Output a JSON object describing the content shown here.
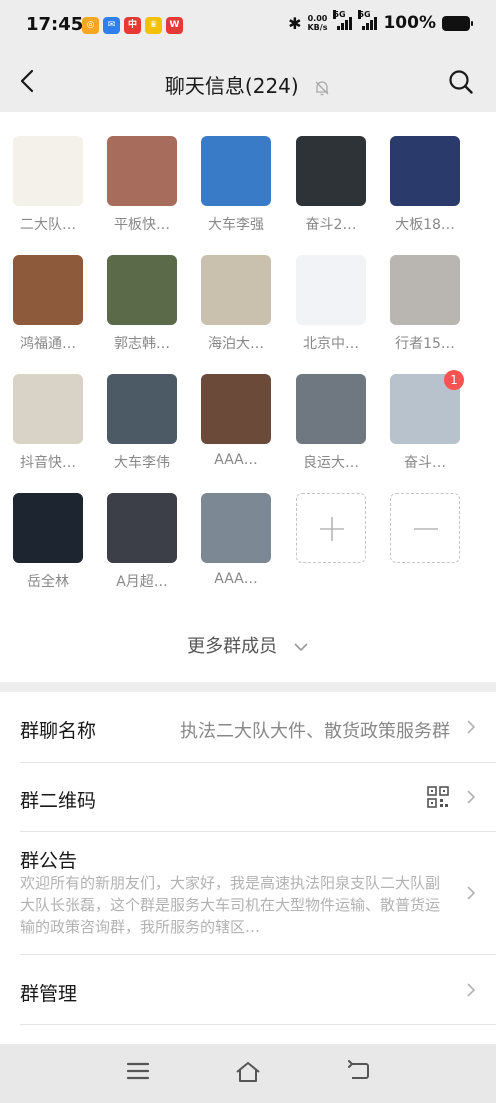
{
  "status_bar": {
    "time": "17:45",
    "app_icons": [
      {
        "name": "app-icon-orange",
        "color": "#f5a623",
        "glyph": "◎"
      },
      {
        "name": "app-icon-blue",
        "color": "#2f80ed",
        "glyph": "✉"
      },
      {
        "name": "app-icon-red",
        "color": "#e53935",
        "glyph": "中"
      },
      {
        "name": "app-icon-yellow",
        "color": "#f2c200",
        "glyph": "♛"
      },
      {
        "name": "app-icon-wps",
        "color": "#e53935",
        "glyph": "W"
      }
    ],
    "speed": "0.00",
    "speed_unit": "KB/s",
    "signal1": "5G",
    "signal2": "5G",
    "battery": "100%"
  },
  "nav": {
    "title": "聊天信息(224)"
  },
  "members": [
    {
      "name": "二大队…",
      "color": "#f4f1ea"
    },
    {
      "name": "平板快…",
      "color": "#a76c5c"
    },
    {
      "name": "大车李强",
      "color": "#3a7bc8"
    },
    {
      "name": "奋斗2…",
      "color": "#2e3338"
    },
    {
      "name": "大板18…",
      "color": "#2a3a6a"
    },
    {
      "name": "鸿福通…",
      "color": "#8e5a3c"
    },
    {
      "name": "郭志韩…",
      "color": "#5b6b4a"
    },
    {
      "name": "海泊大…",
      "color": "#c9c0ae"
    },
    {
      "name": "北京中…",
      "color": "#f2f3f6"
    },
    {
      "name": "行者15…",
      "color": "#b9b6b2"
    },
    {
      "name": "抖音快…",
      "color": "#d8d3c6"
    },
    {
      "name": "大车李伟",
      "color": "#4c5a66"
    },
    {
      "name": "AAA…",
      "color": "#6b4a3a"
    },
    {
      "name": "良运大…",
      "color": "#6f7880"
    },
    {
      "name": "奋斗…",
      "color": "#b7c2cc",
      "badge": "1"
    },
    {
      "name": "岳全林",
      "color": "#1d2530"
    },
    {
      "name": "A月超…",
      "color": "#3c3f48"
    },
    {
      "name": "AAA…",
      "color": "#7c8894"
    }
  ],
  "more_members": "更多群成员",
  "settings": {
    "group_name_label": "群聊名称",
    "group_name_value": "执法二大队大件、散货政策服务群",
    "qr_label": "群二维码",
    "notice_label": "群公告",
    "notice_text": "欢迎所有的新朋友们，大家好，我是高速执法阳泉支队二大队副大队长张磊，这个群是服务大车司机在大型物件运输、散普货运输的政策咨询群，我所服务的辖区…",
    "manage_label": "群管理"
  },
  "colors": {
    "accent_red": "#fa5151",
    "page_bg": "#ededed"
  }
}
